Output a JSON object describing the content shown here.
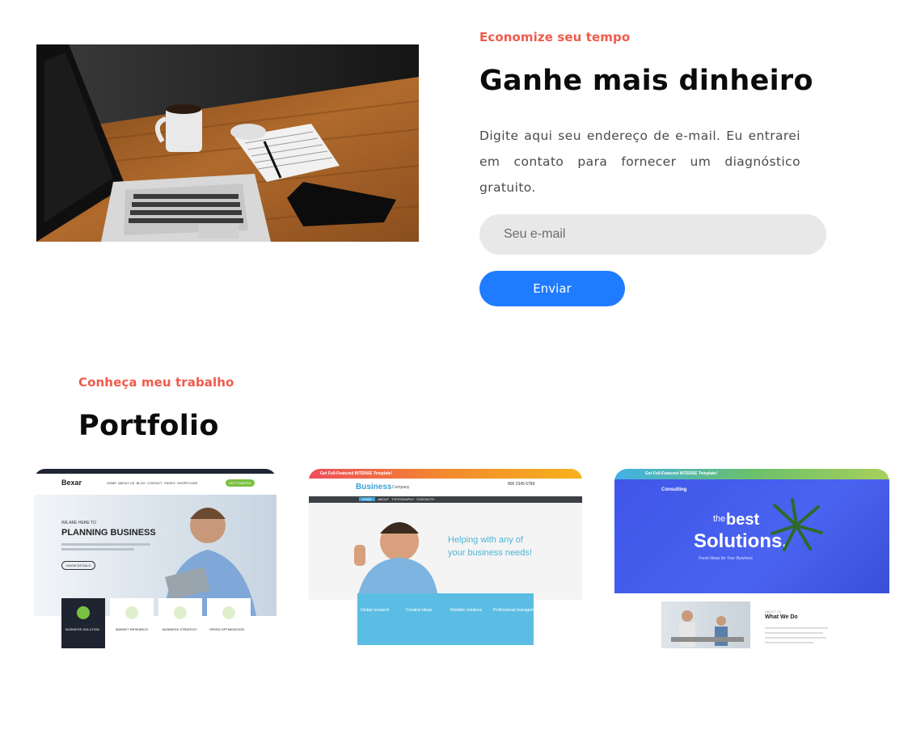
{
  "newsletter": {
    "eyebrow": "Economize seu tempo",
    "title": "Ganhe mais dinheiro",
    "description": "Digite aqui seu endereço de e-mail. Eu entrarei em contato para fornecer um diagnóstico gratuito.",
    "email_placeholder": "Seu e-mail",
    "email_value": "",
    "submit_label": "Enviar"
  },
  "portfolio": {
    "eyebrow": "Conheça meu trabalho",
    "title": "Portfolio",
    "items": [
      {
        "brand": "Bexar",
        "nav": [
          "HOME",
          "ABOUT US",
          "BLOG",
          "CONTACT",
          "PAGES",
          "SHORTCODE"
        ],
        "cta": "GET STARTED",
        "tagline": "WE ARE HERE TO",
        "headline": "PLANNING BUSINESS",
        "button": "KNOW DETAILS",
        "cards": [
          "BUSINESS SOLUTION",
          "MARKET RESEARCH",
          "BUSINESS STRATEGY",
          "SPEED OPTIMIZATION"
        ]
      },
      {
        "banner": "Get Full-Featured INTENSE Template!",
        "brand": "Business",
        "brand_sub": "Company",
        "phone": "800 2345 6789",
        "nav": [
          "HOME",
          "ABOUT",
          "TYPOGRAPHY",
          "CONTACTS"
        ],
        "headline_1": "Helping with any of",
        "headline_2": "your business needs!",
        "features": [
          "Global research",
          "Creative Ideas",
          "Reliable solutions",
          "Professional management"
        ]
      },
      {
        "banner": "Get Full-Featured INTENSE Template!",
        "brand": "Consulting",
        "headline_small": "the",
        "headline_1": "best",
        "headline_2": "Solutions.",
        "tagline": "Fresh Ideas for Your Business",
        "about_eyebrow": "ABOUT US",
        "about_title": "What We Do"
      }
    ]
  },
  "colors": {
    "accent": "#ef5b4c",
    "button": "#1f7bff",
    "input_bg": "#e8e8e8"
  }
}
